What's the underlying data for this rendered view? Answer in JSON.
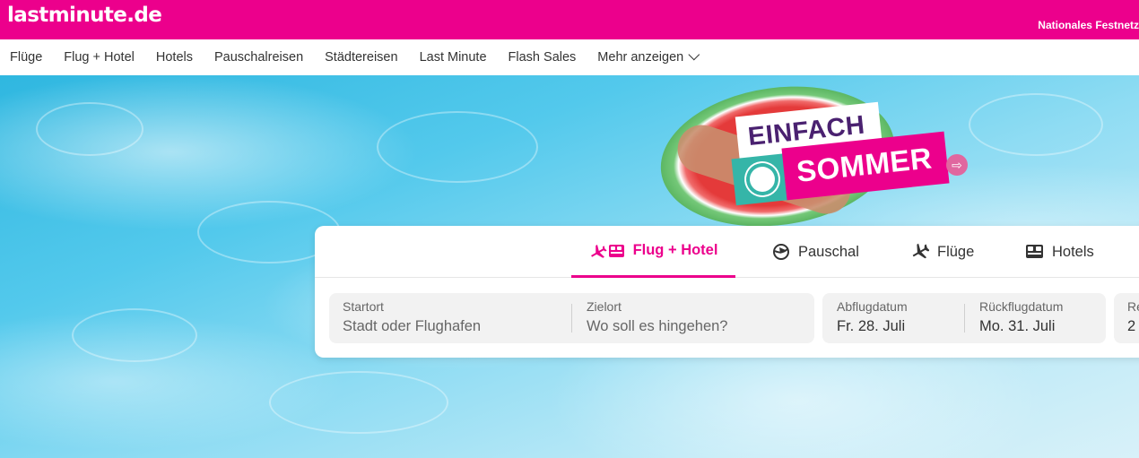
{
  "header": {
    "logo": "lastminute.de",
    "phone_label": "Nationales Festnetz"
  },
  "nav": {
    "items": [
      "Flüge",
      "Flug + Hotel",
      "Hotels",
      "Pauschalreisen",
      "Städtereisen",
      "Last Minute",
      "Flash Sales"
    ],
    "more_label": "Mehr anzeigen"
  },
  "promo": {
    "line1": "EINFACH",
    "line2": "SOMMER"
  },
  "search": {
    "tabs": [
      {
        "label": "Flug + Hotel",
        "icon": "plane-bed-icon"
      },
      {
        "label": "Pauschal",
        "icon": "globe-plane-icon"
      },
      {
        "label": "Flüge",
        "icon": "plane-icon"
      },
      {
        "label": "Hotels",
        "icon": "bed-icon"
      }
    ],
    "origin": {
      "label": "Startort",
      "placeholder": "Stadt oder Flughafen"
    },
    "destination": {
      "label": "Zielort",
      "placeholder": "Wo soll es hingehen?"
    },
    "departure": {
      "label": "Abflugdatum",
      "value": "Fr. 28. Juli"
    },
    "return": {
      "label": "Rückflugdatum",
      "value": "Mo. 31. Juli"
    },
    "travellers": {
      "label": "Re",
      "value": "2"
    }
  },
  "colors": {
    "brand": "#ec008c",
    "promo_purple": "#4a2170",
    "promo_teal": "#35b5a8"
  }
}
